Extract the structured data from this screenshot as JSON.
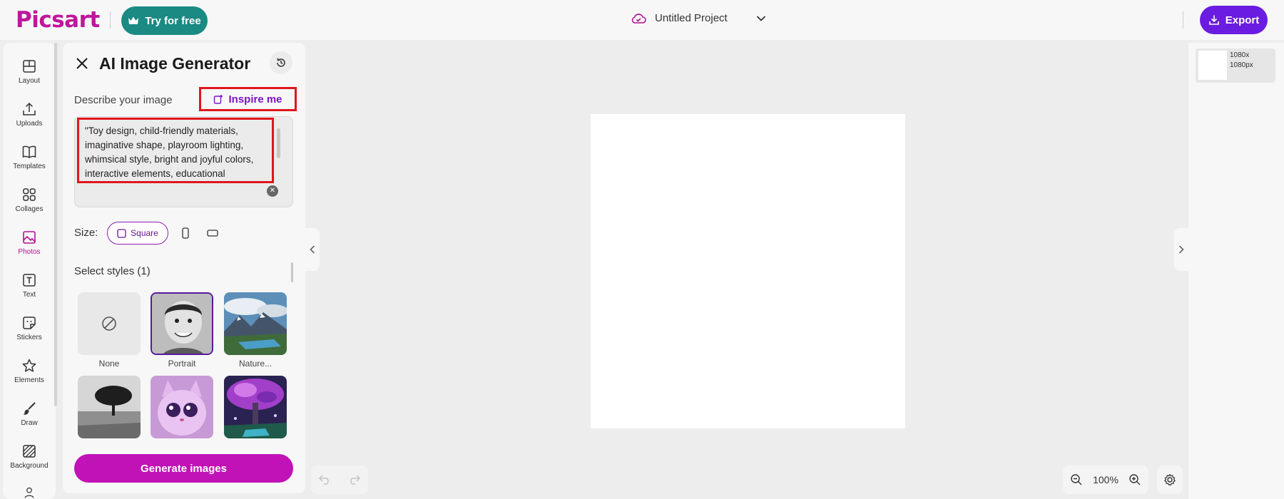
{
  "header": {
    "logo": "Picsart",
    "try_label": "Try for free",
    "project_title": "Untitled Project",
    "export_label": "Export"
  },
  "rail": {
    "items": [
      {
        "label": "Layout",
        "icon": "layout-icon"
      },
      {
        "label": "Uploads",
        "icon": "upload-icon"
      },
      {
        "label": "Templates",
        "icon": "book-icon"
      },
      {
        "label": "Collages",
        "icon": "grid-icon"
      },
      {
        "label": "Photos",
        "icon": "image-icon"
      },
      {
        "label": "Text",
        "icon": "text-icon"
      },
      {
        "label": "Stickers",
        "icon": "sticker-icon"
      },
      {
        "label": "Elements",
        "icon": "star-icon"
      },
      {
        "label": "Draw",
        "icon": "brush-icon"
      },
      {
        "label": "Background",
        "icon": "pattern-icon"
      }
    ],
    "active": "Photos"
  },
  "panel": {
    "title": "AI Image Generator",
    "describe_label": "Describe your image",
    "inspire_label": "Inspire me",
    "prompt": "\"Toy design, child-friendly materials, imaginative shape, playroom lighting, whimsical style, bright and joyful colors, interactive elements, educational",
    "size_label": "Size:",
    "size_square": "Square",
    "styles_label": "Select styles (1)",
    "styles": [
      {
        "caption": "None"
      },
      {
        "caption": "Portrait"
      },
      {
        "caption": "Nature..."
      }
    ],
    "generate_label": "Generate images"
  },
  "canvas": {
    "zoom": "100%"
  },
  "pages": {
    "size_line1": "1080x",
    "size_line2": "1080px"
  },
  "colors": {
    "brand": "#c0159c",
    "export": "#6a1de0",
    "try": "#1a8a83",
    "generate": "#c012b6",
    "highlight": "#e0161d"
  }
}
